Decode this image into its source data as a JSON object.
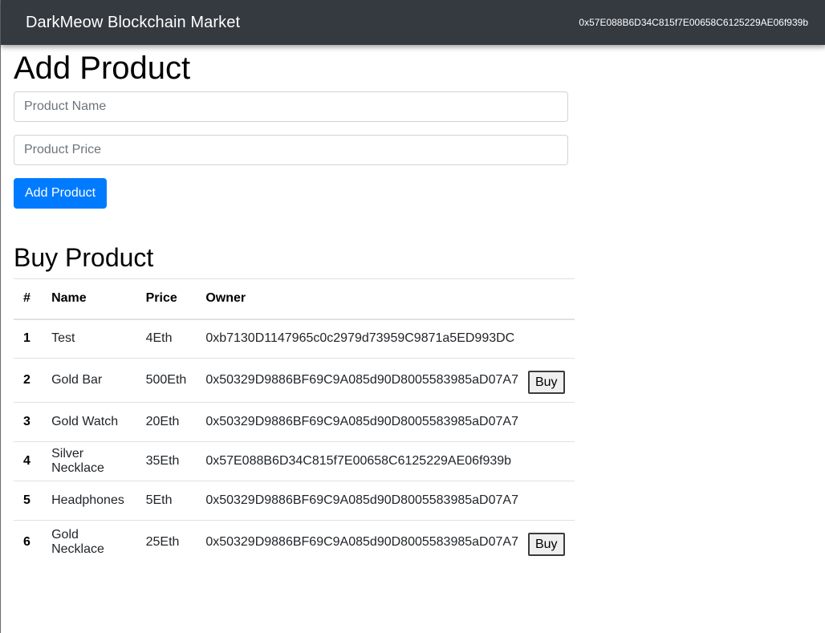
{
  "navbar": {
    "brand": "DarkMeow Blockchain Market",
    "account": "0x57E088B6D34C815f7E00658C6125229AE06f939b"
  },
  "add_product": {
    "title": "Add Product",
    "name_placeholder": "Product Name",
    "price_placeholder": "Product Price",
    "submit_label": "Add Product"
  },
  "buy_product": {
    "title": "Buy Product",
    "headers": [
      "#",
      "Name",
      "Price",
      "Owner"
    ],
    "buy_label": "Buy",
    "rows": [
      {
        "id": "1",
        "name": "Test",
        "price": "4Eth",
        "owner": "0xb7130D1147965c0c2979d73959C9871a5ED993DC",
        "buy": false
      },
      {
        "id": "2",
        "name": "Gold Bar",
        "price": "500Eth",
        "owner": "0x50329D9886BF69C9A085d90D8005583985aD07A7",
        "buy": true
      },
      {
        "id": "3",
        "name": "Gold Watch",
        "price": "20Eth",
        "owner": "0x50329D9886BF69C9A085d90D8005583985aD07A7",
        "buy": false
      },
      {
        "id": "4",
        "name": "Silver Necklace",
        "price": "35Eth",
        "owner": "0x57E088B6D34C815f7E00658C6125229AE06f939b",
        "buy": false
      },
      {
        "id": "5",
        "name": "Headphones",
        "price": "5Eth",
        "owner": "0x50329D9886BF69C9A085d90D8005583985aD07A7",
        "buy": false
      },
      {
        "id": "6",
        "name": "Gold Necklace",
        "price": "25Eth",
        "owner": "0x50329D9886BF69C9A085d90D8005583985aD07A7",
        "buy": true
      }
    ]
  },
  "colors": {
    "navbar_bg": "#343a40",
    "primary": "#007bff"
  }
}
